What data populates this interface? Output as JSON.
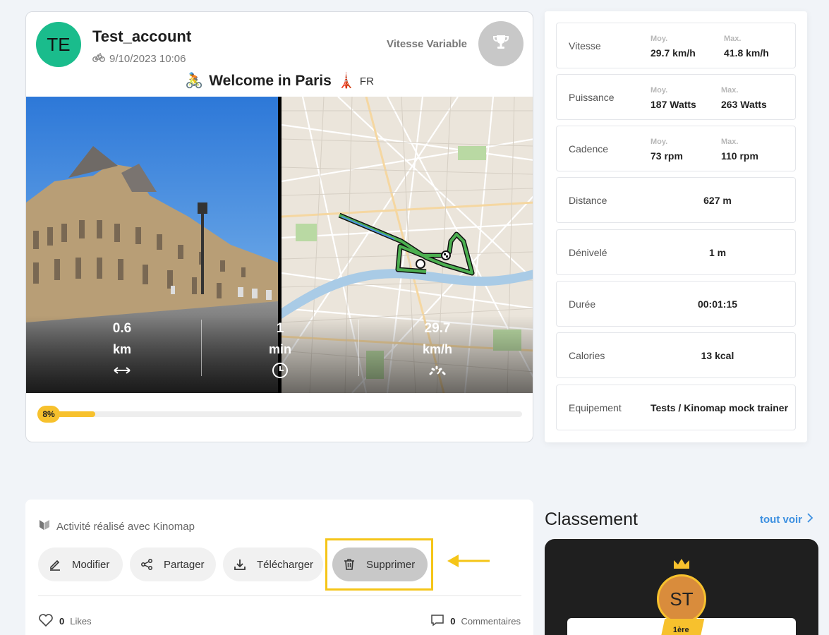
{
  "activity": {
    "avatar_initials": "TE",
    "avatar_color": "#1abc8c",
    "user_name": "Test_account",
    "date": "9/10/2023 10:06",
    "mode": "Vitesse Variable",
    "route_title": "Welcome in Paris",
    "route_emoji": "🚴",
    "landmark_emoji": "🗼",
    "country": "FR",
    "overlay": {
      "distance_value": "0.6",
      "distance_unit": "km",
      "duration_value": "1",
      "duration_unit": "min",
      "speed_value": "29.7",
      "speed_unit": "km/h"
    },
    "progress_percent": 8,
    "progress_label": "8%"
  },
  "stats": {
    "vitesse": {
      "label": "Vitesse",
      "avg_label": "Moy.",
      "avg": "29.7 km/h",
      "max_label": "Max.",
      "max": "41.8 km/h"
    },
    "puissance": {
      "label": "Puissance",
      "avg_label": "Moy.",
      "avg": "187 Watts",
      "max_label": "Max.",
      "max": "263 Watts"
    },
    "cadence": {
      "label": "Cadence",
      "avg_label": "Moy.",
      "avg": "73 rpm",
      "max_label": "Max.",
      "max": "110 rpm"
    },
    "distance": {
      "label": "Distance",
      "value": "627 m"
    },
    "denivele": {
      "label": "Dénivelé",
      "value": "1 m"
    },
    "duree": {
      "label": "Durée",
      "value": "00:01:15"
    },
    "calories": {
      "label": "Calories",
      "value": "13 kcal"
    },
    "equipement": {
      "label": "Equipement",
      "value": "Tests / Kinomap mock trainer"
    }
  },
  "actions": {
    "made_with": "Activité réalisé avec Kinomap",
    "edit": "Modifier",
    "share": "Partager",
    "download": "Télécharger",
    "delete": "Supprimer",
    "likes_count": "0",
    "likes_label": "Likes",
    "comments_count": "0",
    "comments_label": "Commentaires"
  },
  "ranking": {
    "title": "Classement",
    "see_all": "tout voir",
    "first_initials": "ST",
    "first_rank": "1ère"
  },
  "colors": {
    "accent_yellow": "#f7c12d",
    "link_blue": "#3b8fe0",
    "highlight": "#f5c518"
  }
}
